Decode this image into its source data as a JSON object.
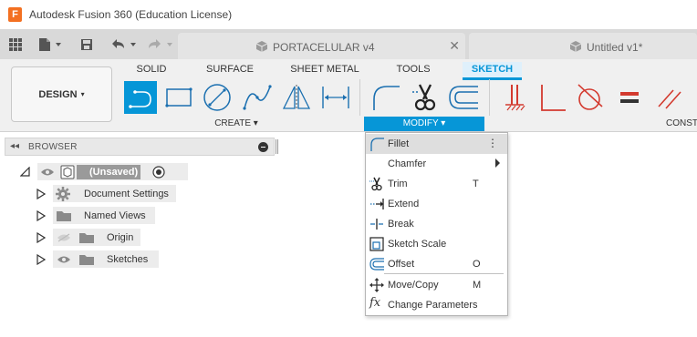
{
  "window": {
    "title": "Autodesk Fusion 360 (Education License)",
    "logo_letter": "F"
  },
  "tabs": [
    {
      "label": "PORTACELULAR v4",
      "close": "✕"
    },
    {
      "label": "Untitled v1*"
    }
  ],
  "toolbar": {
    "workspace": "DESIGN",
    "workspace_caret": "▾",
    "ws_tabs": [
      "SOLID",
      "SURFACE",
      "SHEET METAL",
      "TOOLS",
      "SKETCH"
    ],
    "active_ws_tab": "SKETCH",
    "groups": {
      "create": "CREATE ▾",
      "modify": "MODIFY ▾",
      "constrain": "CONST"
    }
  },
  "browser": {
    "title": "BROWSER",
    "collapse": "◂◂",
    "root_label": "(Unsaved)",
    "items": [
      {
        "label": "Document Settings"
      },
      {
        "label": "Named Views"
      },
      {
        "label": "Origin"
      },
      {
        "label": "Sketches"
      }
    ]
  },
  "menu": {
    "items": [
      {
        "label": "Fillet",
        "shortcut": "",
        "more": "⋮"
      },
      {
        "label": "Chamfer",
        "shortcut": ""
      },
      {
        "label": "Trim",
        "shortcut": "T"
      },
      {
        "label": "Extend",
        "shortcut": ""
      },
      {
        "label": "Break",
        "shortcut": ""
      },
      {
        "label": "Sketch Scale",
        "shortcut": ""
      },
      {
        "label": "Offset",
        "shortcut": "O"
      },
      {
        "label": "Move/Copy",
        "shortcut": "M"
      },
      {
        "label": "Change Parameters",
        "shortcut": ""
      }
    ],
    "icon_glyph_fx": "fx"
  },
  "colors": {
    "accent": "#0696d7",
    "logo": "#f37021",
    "constraint_red": "#d33a2f"
  }
}
